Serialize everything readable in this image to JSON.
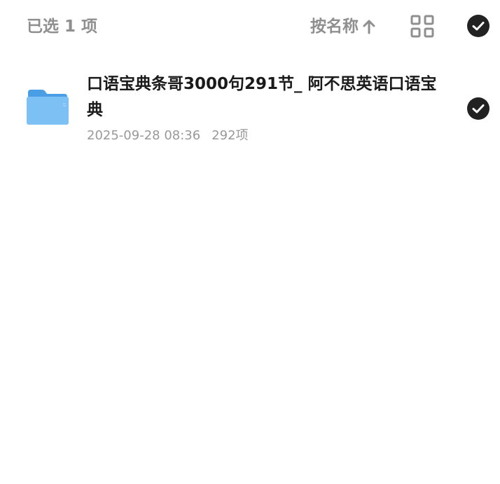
{
  "toolbar": {
    "selected_label": "已选 1 项",
    "sort_label": "按名称",
    "sort_icon": "arrow-up-icon",
    "view_icon": "grid-view-icon",
    "select_all_icon": "check-circle-icon"
  },
  "files": [
    {
      "icon": "folder-icon",
      "name": "口语宝典条哥3000句291节_ 阿不思英语口语宝典",
      "date": "2025-09-28 08:36",
      "count": "292项",
      "selected": true
    }
  ],
  "colors": {
    "muted_text": "#8f8f8f",
    "meta_text": "#999999",
    "primary_text": "#1a1a1a",
    "check_fill": "#222222",
    "folder_blue": "#5fb0ee"
  }
}
